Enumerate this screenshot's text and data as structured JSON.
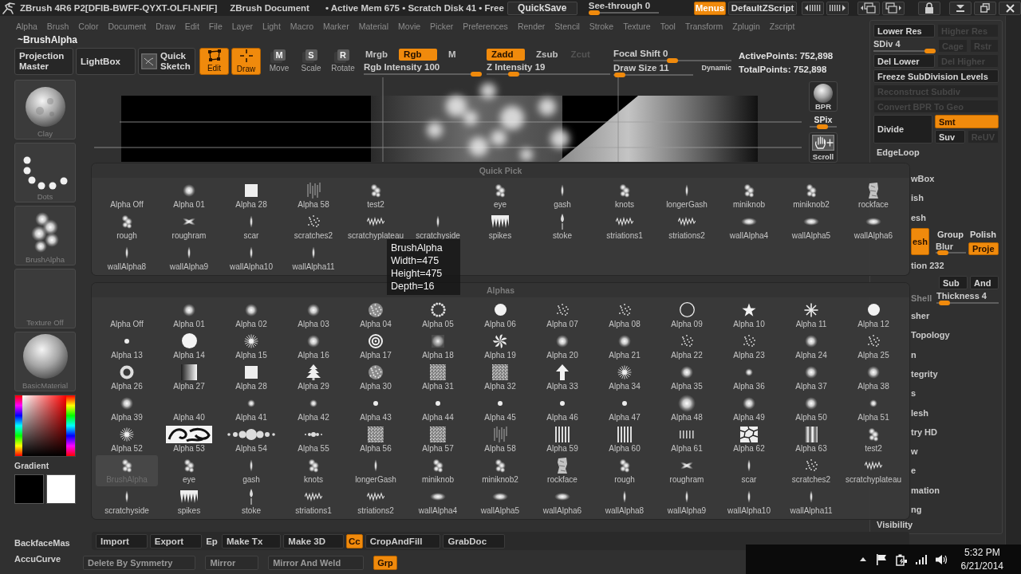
{
  "title_bar": {
    "title": "ZBrush 4R6 P2[DFIB-BWFF-QYXT-OLFI-NFIF]",
    "document": "ZBrush Document",
    "stats": "• Active Mem 675 • Scratch Disk 41 • Free",
    "quicksave": "QuickSave",
    "see_through": {
      "label": "See-through 0",
      "level": 0
    },
    "menus": {
      "label": "Menus",
      "on": true
    },
    "zscript": "DefaultZScript"
  },
  "menu_bar": [
    "Alpha",
    "Brush",
    "Color",
    "Document",
    "Draw",
    "Edit",
    "File",
    "Layer",
    "Light",
    "Macro",
    "Marker",
    "Material",
    "Movie",
    "Picker",
    "Preferences",
    "Render",
    "Stencil",
    "Stroke",
    "Texture",
    "Tool",
    "Transform",
    "Zplugin",
    "Zscript"
  ],
  "palette_title": "~BrushAlpha",
  "toolbar": {
    "tools": [
      {
        "label": "Projection Master",
        "kind": "projection",
        "on": false
      },
      {
        "label": "LightBox",
        "kind": "lightbox",
        "on": false
      },
      {
        "label": "Quick Sketch",
        "kind": "sketch",
        "on": false
      },
      {
        "label": "Edit",
        "kind": "edit",
        "on": true
      },
      {
        "label": "Draw",
        "kind": "draw",
        "on": true
      },
      {
        "label": "Move",
        "kind": "move",
        "key": "M",
        "on": false
      },
      {
        "label": "Scale",
        "kind": "scale",
        "key": "S",
        "on": false
      },
      {
        "label": "Rotate",
        "kind": "rotate",
        "key": "R",
        "on": false
      }
    ],
    "color_modes": [
      {
        "label": "Mrgb",
        "on": false
      },
      {
        "label": "Rgb",
        "on": true
      },
      {
        "label": "M",
        "on": false
      }
    ],
    "rgb_intensity": {
      "label": "Rgb Intensity 100",
      "level": 1
    },
    "z_modes": [
      {
        "label": "Zadd",
        "on": true,
        "disabled": false
      },
      {
        "label": "Zsub",
        "on": false,
        "disabled": false
      },
      {
        "label": "Zcut",
        "on": false,
        "disabled": true
      }
    ],
    "z_intensity": {
      "label": "Z Intensity 19",
      "level": 0.19
    },
    "focal_shift": {
      "label": "Focal Shift 0",
      "level": 0.5
    },
    "draw_size": {
      "label": "Draw Size 11",
      "level": 0.01
    },
    "dynamic": "Dynamic",
    "points": [
      "ActivePoints: 752,898",
      "TotalPoints: 752,898"
    ]
  },
  "left_shelf": {
    "tiles": [
      {
        "label": "Clay",
        "kind": "brush"
      },
      {
        "label": "Dots",
        "kind": "stroke"
      },
      {
        "label": "BrushAlpha",
        "kind": "alpha"
      },
      {
        "label": "Texture Off",
        "kind": "texture"
      },
      {
        "label": "BasicMaterial",
        "kind": "material"
      }
    ],
    "gradient_label": "Gradient",
    "swatches": [
      {
        "color": "#000000"
      },
      {
        "color": "#ffffff"
      }
    ],
    "buttons": [
      "BackfaceMas",
      "AccuCurve"
    ]
  },
  "right_shelf": {
    "bpr": "BPR",
    "spix": {
      "label": "SPix",
      "level": 0.43
    },
    "scroll": "Scroll"
  },
  "quick_pick": {
    "title": "Quick Pick",
    "items": [
      {
        "label": "Alpha Off",
        "kind": "none"
      },
      {
        "label": "Alpha 01",
        "kind": "soft"
      },
      {
        "label": "Alpha 28",
        "kind": "square"
      },
      {
        "label": "Alpha 58",
        "kind": "streaks"
      },
      {
        "label": "test2",
        "kind": "smudge"
      },
      {
        "kind": "blank"
      },
      {
        "label": "eye",
        "kind": "smudge"
      },
      {
        "label": "gash",
        "kind": "streak"
      },
      {
        "label": "knots",
        "kind": "smudge"
      },
      {
        "label": "longerGash",
        "kind": "streak"
      },
      {
        "label": "miniknob",
        "kind": "smudge"
      },
      {
        "label": "miniknob2",
        "kind": "smudge"
      },
      {
        "label": "rockface",
        "kind": "rock"
      },
      {
        "label": "rough",
        "kind": "smudge"
      },
      {
        "label": "roughram",
        "kind": "cross"
      },
      {
        "label": "scar",
        "kind": "streak"
      },
      {
        "label": "scratches2",
        "kind": "speckle"
      },
      {
        "label": "scratchyplateau",
        "kind": "jagged"
      },
      {
        "label": "scratchyside",
        "kind": "streak"
      },
      {
        "label": "spikes",
        "kind": "comb"
      },
      {
        "label": "stoke",
        "kind": "drip"
      },
      {
        "label": "striations1",
        "kind": "jagged"
      },
      {
        "label": "striations2",
        "kind": "jagged"
      },
      {
        "label": "wallAlpha4",
        "kind": "smear"
      },
      {
        "label": "wallAlpha5",
        "kind": "smear"
      },
      {
        "label": "wallAlpha6",
        "kind": "smear"
      },
      {
        "label": "wallAlpha8",
        "kind": "streak"
      },
      {
        "label": "wallAlpha9",
        "kind": "streak"
      },
      {
        "label": "wallAlpha10",
        "kind": "streak"
      },
      {
        "label": "wallAlpha11",
        "kind": "streak"
      }
    ]
  },
  "tooltip": [
    "BrushAlpha",
    "Width=475",
    "Height=475",
    "Depth=16"
  ],
  "alphas": {
    "title": "Alphas",
    "items": [
      {
        "label": "Alpha Off",
        "kind": "none",
        "selected": false
      },
      {
        "label": "Alpha 01",
        "kind": "soft",
        "selected": false
      },
      {
        "label": "Alpha 02",
        "kind": "soft",
        "selected": false
      },
      {
        "label": "Alpha 03",
        "kind": "soft",
        "selected": false
      },
      {
        "label": "Alpha 04",
        "kind": "speckle-ball",
        "selected": false
      },
      {
        "label": "Alpha 05",
        "kind": "ring-dots",
        "selected": false
      },
      {
        "label": "Alpha 06",
        "kind": "disc",
        "selected": false
      },
      {
        "label": "Alpha 07",
        "kind": "speckle",
        "selected": false
      },
      {
        "label": "Alpha 08",
        "kind": "speckle",
        "selected": false
      },
      {
        "label": "Alpha 09",
        "kind": "ring",
        "selected": false
      },
      {
        "label": "Alpha 10",
        "kind": "star",
        "selected": false
      },
      {
        "label": "Alpha 11",
        "kind": "asterisk",
        "selected": false
      },
      {
        "label": "Alpha 12",
        "kind": "disc",
        "selected": false
      },
      {
        "label": "Alpha 13",
        "kind": "dot",
        "selected": false
      },
      {
        "label": "Alpha 14",
        "kind": "disc-big",
        "selected": false
      },
      {
        "label": "Alpha 15",
        "kind": "burst",
        "selected": false
      },
      {
        "label": "Alpha 16",
        "kind": "soft",
        "selected": false
      },
      {
        "label": "Alpha 17",
        "kind": "target",
        "selected": false
      },
      {
        "label": "Alpha 18",
        "kind": "soft-square",
        "selected": false
      },
      {
        "label": "Alpha 19",
        "kind": "swirl",
        "selected": false
      },
      {
        "label": "Alpha 20",
        "kind": "soft",
        "selected": false
      },
      {
        "label": "Alpha 21",
        "kind": "soft",
        "selected": false
      },
      {
        "label": "Alpha 22",
        "kind": "speckle",
        "selected": false
      },
      {
        "label": "Alpha 23",
        "kind": "speckle",
        "selected": false
      },
      {
        "label": "Alpha 24",
        "kind": "soft",
        "selected": false
      },
      {
        "label": "Alpha 25",
        "kind": "speckle",
        "selected": false
      },
      {
        "label": "Alpha 26",
        "kind": "donut",
        "selected": false
      },
      {
        "label": "Alpha 27",
        "kind": "gradient",
        "selected": false
      },
      {
        "label": "Alpha 28",
        "kind": "square",
        "selected": false
      },
      {
        "label": "Alpha 29",
        "kind": "tree",
        "selected": false
      },
      {
        "label": "Alpha 30",
        "kind": "speckle-ball",
        "selected": false
      },
      {
        "label": "Alpha 31",
        "kind": "noise",
        "selected": false
      },
      {
        "label": "Alpha 32",
        "kind": "noise",
        "selected": false
      },
      {
        "label": "Alpha 33",
        "kind": "arrow",
        "selected": false
      },
      {
        "label": "Alpha 34",
        "kind": "burst",
        "selected": false
      },
      {
        "label": "Alpha 35",
        "kind": "soft",
        "selected": false
      },
      {
        "label": "Alpha 36",
        "kind": "soft-small",
        "selected": false
      },
      {
        "label": "Alpha 37",
        "kind": "soft",
        "selected": false
      },
      {
        "label": "Alpha 38",
        "kind": "soft",
        "selected": false
      },
      {
        "label": "Alpha 39",
        "kind": "soft",
        "selected": false
      },
      {
        "label": "Alpha 40",
        "kind": "none",
        "selected": false
      },
      {
        "label": "Alpha 41",
        "kind": "soft-small",
        "selected": false
      },
      {
        "label": "Alpha 42",
        "kind": "soft-small",
        "selected": false
      },
      {
        "label": "Alpha 43",
        "kind": "dot",
        "selected": false
      },
      {
        "label": "Alpha 44",
        "kind": "dot",
        "selected": false
      },
      {
        "label": "Alpha 45",
        "kind": "dot",
        "selected": false
      },
      {
        "label": "Alpha 46",
        "kind": "dot",
        "selected": false
      },
      {
        "label": "Alpha 47",
        "kind": "dot",
        "selected": false
      },
      {
        "label": "Alpha 48",
        "kind": "soft-big",
        "selected": false
      },
      {
        "label": "Alpha 49",
        "kind": "soft",
        "selected": false
      },
      {
        "label": "Alpha 50",
        "kind": "soft",
        "selected": false
      },
      {
        "label": "Alpha 51",
        "kind": "soft-small",
        "selected": false
      },
      {
        "label": "Alpha 52",
        "kind": "burst",
        "selected": false
      },
      {
        "label": "Alpha 53",
        "kind": "ornament",
        "selected": false
      },
      {
        "label": "Alpha 54",
        "kind": "beads",
        "selected": false
      },
      {
        "label": "Alpha 55",
        "kind": "beads-small",
        "selected": false
      },
      {
        "label": "Alpha 56",
        "kind": "noise",
        "selected": false
      },
      {
        "label": "Alpha 57",
        "kind": "noise",
        "selected": false
      },
      {
        "label": "Alpha 58",
        "kind": "streaks",
        "selected": false
      },
      {
        "label": "Alpha 59",
        "kind": "stripes",
        "selected": false
      },
      {
        "label": "Alpha 60",
        "kind": "stripes",
        "selected": false
      },
      {
        "label": "Alpha 61",
        "kind": "stripes-small",
        "selected": false
      },
      {
        "label": "Alpha 62",
        "kind": "cells",
        "selected": false
      },
      {
        "label": "Alpha 63",
        "kind": "gradient-stripes",
        "selected": false
      },
      {
        "label": "test2",
        "kind": "smudge",
        "selected": false
      },
      {
        "label": "BrushAlpha",
        "kind": "smudge",
        "selected": true
      },
      {
        "label": "eye",
        "kind": "smudge",
        "selected": false
      },
      {
        "label": "gash",
        "kind": "streak",
        "selected": false
      },
      {
        "label": "knots",
        "kind": "smudge",
        "selected": false
      },
      {
        "label": "longerGash",
        "kind": "streak",
        "selected": false
      },
      {
        "label": "miniknob",
        "kind": "smudge",
        "selected": false
      },
      {
        "label": "miniknob2",
        "kind": "smudge",
        "selected": false
      },
      {
        "label": "rockface",
        "kind": "rock",
        "selected": false
      },
      {
        "label": "rough",
        "kind": "smudge",
        "selected": false
      },
      {
        "label": "roughram",
        "kind": "cross",
        "selected": false
      },
      {
        "label": "scar",
        "kind": "streak",
        "selected": false
      },
      {
        "label": "scratches2",
        "kind": "speckle",
        "selected": false
      },
      {
        "label": "scratchyplateau",
        "kind": "jagged",
        "selected": false
      },
      {
        "label": "scratchyside",
        "kind": "streak",
        "selected": false
      },
      {
        "label": "spikes",
        "kind": "comb",
        "selected": false
      },
      {
        "label": "stoke",
        "kind": "drip",
        "selected": false
      },
      {
        "label": "striations1",
        "kind": "jagged",
        "selected": false
      },
      {
        "label": "striations2",
        "kind": "jagged",
        "selected": false
      },
      {
        "label": "wallAlpha4",
        "kind": "smear",
        "selected": false
      },
      {
        "label": "wallAlpha5",
        "kind": "smear",
        "selected": false
      },
      {
        "label": "wallAlpha6",
        "kind": "smear",
        "selected": false
      },
      {
        "label": "wallAlpha8",
        "kind": "streak",
        "selected": false
      },
      {
        "label": "wallAlpha9",
        "kind": "streak",
        "selected": false
      },
      {
        "label": "wallAlpha10",
        "kind": "streak",
        "selected": false
      },
      {
        "label": "wallAlpha11",
        "kind": "streak",
        "selected": false
      }
    ]
  },
  "import_bar": [
    {
      "label": "Import",
      "kind": "button",
      "on": false
    },
    {
      "label": "Export",
      "kind": "button",
      "on": false
    },
    {
      "label": "Ep",
      "kind": "cut",
      "on": false
    },
    {
      "label": "Make Tx",
      "kind": "button",
      "on": false
    },
    {
      "label": "Make 3D",
      "kind": "button",
      "on": false
    },
    {
      "label": "Cc",
      "kind": "button",
      "on": true
    },
    {
      "label": "CropAndFill",
      "kind": "button",
      "on": false
    },
    {
      "label": "GrabDoc",
      "kind": "button",
      "on": false
    }
  ],
  "bottom_row": [
    {
      "label": "Delete By Symmetry",
      "on": false
    },
    {
      "label": "Mirror",
      "on": false
    },
    {
      "label": "Mirror And Weld",
      "on": false
    },
    {
      "label": "Grp",
      "on": true
    }
  ],
  "right_panel": {
    "rows": [
      {
        "kind": "pair",
        "items": [
          {
            "label": "Lower Res",
            "on": false,
            "disabled": false
          },
          {
            "label": "Higher Res",
            "on": false,
            "disabled": true
          }
        ]
      },
      {
        "kind": "slider",
        "slider": {
          "label": "SDiv 4",
          "level": 1
        },
        "items": [
          {
            "label": "Cage",
            "on": false,
            "disabled": true
          },
          {
            "label": "Rstr",
            "on": false,
            "disabled": true
          }
        ]
      },
      {
        "kind": "pair",
        "items": [
          {
            "label": "Del Lower",
            "on": false,
            "disabled": false
          },
          {
            "label": "Del Higher",
            "on": false,
            "disabled": true
          }
        ]
      },
      {
        "kind": "wide",
        "items": [
          {
            "label": "Freeze SubDivision Levels",
            "on": false,
            "disabled": false
          }
        ]
      },
      {
        "kind": "wide",
        "items": [
          {
            "label": "Reconstruct Subdiv",
            "on": false,
            "disabled": true
          }
        ]
      },
      {
        "kind": "wide",
        "items": [
          {
            "label": "Convert BPR To Geo",
            "on": false,
            "disabled": true
          }
        ]
      },
      {
        "kind": "divide",
        "items": [
          {
            "label": "Divide",
            "on": false,
            "disabled": false
          },
          {
            "label": "Smt",
            "on": true,
            "disabled": false
          },
          {
            "label": "Suv",
            "on": false,
            "disabled": false
          },
          {
            "label": "ReUV",
            "on": false,
            "disabled": true
          }
        ]
      },
      {
        "kind": "header",
        "label": "EdgeLoop"
      },
      {
        "kind": "cut",
        "label": "wBox"
      },
      {
        "kind": "cut",
        "label": "ish"
      },
      {
        "kind": "cut",
        "label": "esh"
      },
      {
        "kind": "dynamesh",
        "items": [
          {
            "label": "esh",
            "on": true,
            "disabled": false
          },
          {
            "label": "Group",
            "on": false,
            "disabled": false
          },
          {
            "label": "Polish",
            "on": false,
            "disabled": false
          },
          {
            "label": "Proje",
            "on": true,
            "disabled": false
          }
        ],
        "slider": {
          "label": "Blur",
          "level": 0.1
        }
      },
      {
        "kind": "cut",
        "label": "tion 232"
      },
      {
        "kind": "right-pair",
        "items": [
          {
            "label": "Sub",
            "on": false,
            "disabled": false
          },
          {
            "label": "And",
            "on": false,
            "disabled": false
          }
        ]
      },
      {
        "kind": "cut-slider",
        "label": "Shell",
        "slider": {
          "label": "Thickness 4",
          "level": 0.04
        }
      },
      {
        "kind": "cut",
        "label": "sher"
      },
      {
        "kind": "cut",
        "label": "Topology"
      },
      {
        "kind": "cut",
        "label": "n"
      },
      {
        "kind": "cut",
        "label": "tegrity"
      },
      {
        "kind": "cut",
        "label": "s"
      },
      {
        "kind": "cut",
        "label": "lesh"
      },
      {
        "kind": "cut",
        "label": "try HD"
      },
      {
        "kind": "cut",
        "label": "w"
      },
      {
        "kind": "cut",
        "label": "e"
      },
      {
        "kind": "cut",
        "label": "mation"
      },
      {
        "kind": "cut",
        "label": "ng"
      },
      {
        "kind": "header",
        "label": "Visibility"
      }
    ]
  },
  "taskbar": {
    "time": "5:32 PM",
    "date": "6/21/2014"
  }
}
